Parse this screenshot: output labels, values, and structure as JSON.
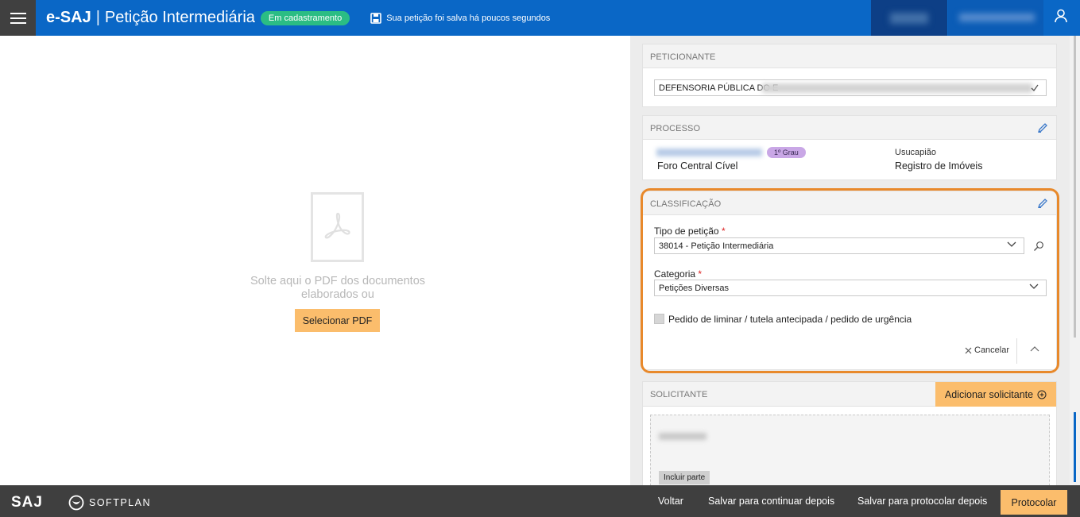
{
  "header": {
    "app_name": "e-SAJ",
    "page_title": "Petição Intermediária",
    "status_badge": "Em cadastramento",
    "save_status": "Sua petição foi salva há poucos segundos"
  },
  "upload": {
    "drop_text": "Solte aqui o PDF dos documentos elaborados ou",
    "select_button": "Selecionar PDF"
  },
  "peticionante": {
    "title": "PETICIONANTE",
    "selected": "DEFENSORIA PÚBLICA DO E"
  },
  "processo": {
    "title": "PROCESSO",
    "grau_badge": "1º Grau",
    "foro": "Foro Central Cível",
    "classe": "Usucapião",
    "assunto": "Registro de Imóveis"
  },
  "classificacao": {
    "title": "CLASSIFICAÇÃO",
    "tipo_label": "Tipo de petição",
    "tipo_value": "38014 - Petição Intermediária",
    "categoria_label": "Categoria",
    "categoria_value": "Petições Diversas",
    "required_mark": "*",
    "checkbox_label": "Pedido de liminar / tutela antecipada / pedido de urgência",
    "cancel_label": "Cancelar"
  },
  "solicitante": {
    "title": "SOLICITANTE",
    "add_button": "Adicionar solicitante",
    "include_button": "Incluir parte"
  },
  "footer": {
    "logo_saj": "SAJ",
    "logo_softplan": "SOFTPLAN",
    "voltar": "Voltar",
    "salvar_continuar": "Salvar para continuar depois",
    "salvar_protocolar": "Salvar para protocolar depois",
    "protocolar": "Protocolar"
  },
  "colors": {
    "header_blue": "#0a67c6",
    "accent_orange": "#fbbd6c",
    "highlight_orange": "#e8892b",
    "status_green": "#2bbd84",
    "footer_dark": "#3f3f3f"
  }
}
